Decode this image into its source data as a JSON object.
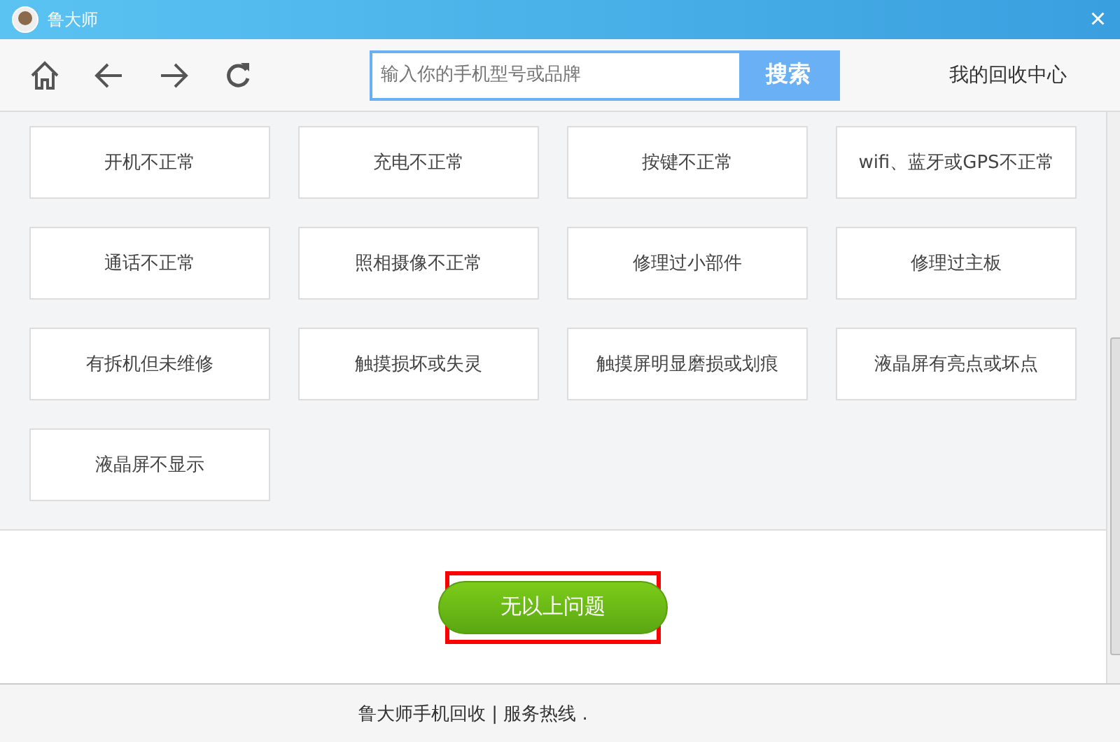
{
  "window": {
    "title": "鲁大师",
    "close": "×"
  },
  "toolbar": {
    "search": {
      "placeholder": "输入你的手机型号或品牌",
      "button": "搜索"
    },
    "link": "我的回收中心"
  },
  "problems": [
    {
      "label": "开机不正常"
    },
    {
      "label": "充电不正常"
    },
    {
      "label": "按键不正常"
    },
    {
      "label": "wifi、蓝牙或GPS不正常"
    },
    {
      "label": "通话不正常"
    },
    {
      "label": "照相摄像不正常"
    },
    {
      "label": "修理过小部件"
    },
    {
      "label": "修理过主板"
    },
    {
      "label": "有拆机但未维修"
    },
    {
      "label": "触摸损坏或失灵"
    },
    {
      "label": "触摸屏明显磨损或划痕"
    },
    {
      "label": "液晶屏有亮点或坏点"
    },
    {
      "label": "液晶屏不显示"
    }
  ],
  "confirm_button": "无以上问题",
  "footer": "鲁大师手机回收 | 服务热线 ."
}
